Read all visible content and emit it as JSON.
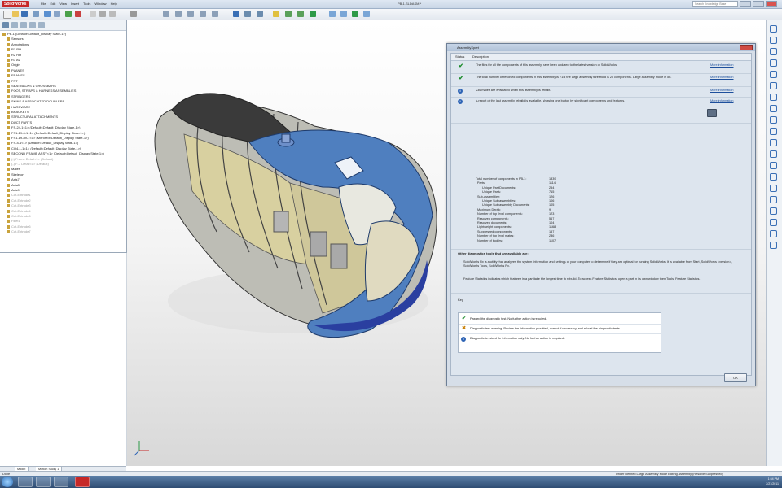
{
  "app": {
    "logo": "SolidWorks",
    "menu": [
      "File",
      "Edit",
      "View",
      "Insert",
      "Tools",
      "Window",
      "Help"
    ],
    "doc_title": "PB-1.SLDASM *",
    "search_placeholder": "Search Knowledge Base"
  },
  "tree": {
    "items": [
      {
        "label": "PB-1 (Default<Default_Display State-1>)",
        "sup": false
      },
      {
        "label": "Sensors",
        "sup": false
      },
      {
        "label": "Annotations",
        "sup": false
      },
      {
        "label": "R1 RH",
        "sup": false
      },
      {
        "label": "R2 RH",
        "sup": false
      },
      {
        "label": "R3 AV",
        "sup": false
      },
      {
        "label": "Origin",
        "sup": false
      },
      {
        "label": "PLANES",
        "sup": false
      },
      {
        "label": "FRAMES",
        "sup": false
      },
      {
        "label": "FRT",
        "sup": false
      },
      {
        "label": "SEAT BACKS & CROSSBARS",
        "sup": false
      },
      {
        "label": "FOOT, STRAPS & HARNESS ASSEMBLIES",
        "sup": false
      },
      {
        "label": "STRINGERS",
        "sup": false
      },
      {
        "label": "SKINS & ASSOCIATED DOUBLERS",
        "sup": false
      },
      {
        "label": "HARDWARE",
        "sup": false
      },
      {
        "label": "BRACKETS",
        "sup": false
      },
      {
        "label": "STRUCTURAL ATTACHMENTS",
        "sup": false
      },
      {
        "label": "DUCT PARTS",
        "sup": false
      },
      {
        "label": "FS-24-1<1> (Default<Default_Display State-1>)",
        "sup": false
      },
      {
        "label": "FS1-19-0-1<1> (Default<Default_Display State-1>)",
        "sup": false
      },
      {
        "label": "FS1-19-89-1<1> (Mirrored<Default_Display State-1>)",
        "sup": false
      },
      {
        "label": "FS-4-1<1> (Default<Default_Display State-1>)",
        "sup": false
      },
      {
        "label": "CO4-1-1<1> (Default<Default_Display State-1>)",
        "sup": false
      },
      {
        "label": "SECOND FRAME ASSY<1> (Default<Default_Display State-1>)",
        "sup": false
      },
      {
        "label": "(-) Frame Detail<1> (Default)",
        "sup": true
      },
      {
        "label": "(-) F-7 Detail<1> (Default)",
        "sup": true
      },
      {
        "label": "Mates",
        "sup": false
      },
      {
        "label": "Skeleton",
        "sup": false
      },
      {
        "label": "Axis7",
        "sup": false
      },
      {
        "label": "Axis8",
        "sup": false
      },
      {
        "label": "Axis9",
        "sup": false
      },
      {
        "label": "Cut-Extrude1",
        "sup": true
      },
      {
        "label": "Cut-Extrude2",
        "sup": true
      },
      {
        "label": "Cut-Extrude3",
        "sup": true
      },
      {
        "label": "Cut-Extrude4",
        "sup": true
      },
      {
        "label": "Cut-Extrude5",
        "sup": true
      },
      {
        "label": "Fillet1",
        "sup": true
      },
      {
        "label": "Cut-Extrude6",
        "sup": true
      },
      {
        "label": "Cut-Extrude7",
        "sup": true
      }
    ]
  },
  "dialog": {
    "title": "AssemblyXpert",
    "col_status": "Status",
    "col_desc": "Description",
    "rows": [
      {
        "status": "check",
        "text": "The files for all the components of this assembly have been updated to the latest version of SolidWorks.",
        "link": "More information"
      },
      {
        "status": "check",
        "text": "The total number of resolved components in this assembly is 714; the large assembly threshold is 20 components. Large assembly mode is on.",
        "link": "More information"
      },
      {
        "status": "info",
        "text": "236 mates are evaluated when this assembly is rebuilt.",
        "link": "More information"
      },
      {
        "status": "info",
        "text": "A report of the last assembly rebuild is available, showing one button by significant components and features.",
        "link": "More information"
      }
    ],
    "stats_title": "Total number of components in PB-1:",
    "stats": [
      {
        "label": "Total number of components in PB-1:",
        "value": "1839"
      },
      {
        "label": "Parts:",
        "value": "1114"
      },
      {
        "label": "Unique Part Documents:",
        "value": "254"
      },
      {
        "label": "Unique Parts:",
        "value": "715"
      },
      {
        "label": "Sub-assemblies:",
        "value": "126"
      },
      {
        "label": "Unique Sub-assemblies:",
        "value": "106"
      },
      {
        "label": "Unique Sub-assembly Documents:",
        "value": "105"
      },
      {
        "label": "Maximum Depth:",
        "value": "9"
      },
      {
        "label": "Number of top level components:",
        "value": "123"
      },
      {
        "label": "Resolved components:",
        "value": "567"
      },
      {
        "label": "Resolved documents:",
        "value": "104"
      },
      {
        "label": "Lightweight components:",
        "value": "1168"
      },
      {
        "label": "Suppressed components:",
        "value": "157"
      },
      {
        "label": "Number of top level mates:",
        "value": "236"
      },
      {
        "label": "Number of bodies:",
        "value": "1107"
      }
    ],
    "tools_title": "Other diagnostics tools that are available are:",
    "tools_p1": "SolidWorks Rx is a utility that analyzes the system information and settings of your computer to determine if they are optimal for running SolidWorks. It is available from Start, SolidWorks <version>, SolidWorks Tools, SolidWorks Rx.",
    "tools_p2": "Feature Statistics indicates which features in a part take the longest time to rebuild. To access Feature Statistics, open a part in its own window then Tools, Feature Statistics.",
    "key_title": "Key",
    "key": [
      {
        "status": "check",
        "text": "Passed the diagnostic test. No further action is required."
      },
      {
        "status": "warn",
        "text": "Diagnostic test warning. Review the information provided, correct if necessary, and reload the diagnostic tests."
      },
      {
        "status": "info",
        "text": "Diagnostic is raised for information only. No further action is required."
      }
    ],
    "ok_label": "OK"
  },
  "bottom_tabs": [
    "Model",
    "Motion Study 1"
  ],
  "status": {
    "left": "Done",
    "right": "Under Defined   Large Assembly Mode   Editing Assembly (Resolve Suppressed)"
  },
  "clock": {
    "time": "1:54 PM",
    "date": "2/21/2011"
  },
  "colors": {
    "fuselage_blue": "#4f7fbf",
    "frame_yellow": "#d8d0a0",
    "accent": "#2e64b5"
  }
}
